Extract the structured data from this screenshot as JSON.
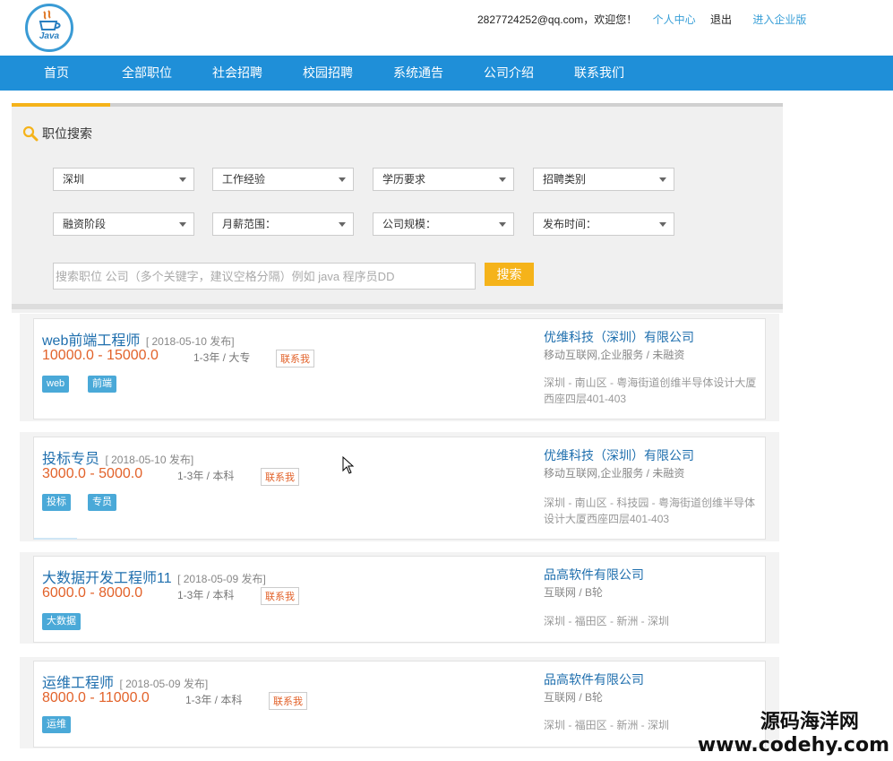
{
  "header": {
    "logo_text": "Java",
    "email": "2827724252@qq.com",
    "welcome": "，欢迎您！",
    "personal_center": "个人中心",
    "logout": "退出",
    "enterprise": "进入企业版"
  },
  "nav": {
    "items": [
      "首页",
      "全部职位",
      "社会招聘",
      "校园招聘",
      "系统通告",
      "公司介绍",
      "联系我们"
    ]
  },
  "search": {
    "title": "职位搜索",
    "filters": [
      "深圳",
      "工作经验",
      "学历要求",
      "招聘类别",
      "融资阶段",
      "月薪范围：",
      "公司规模：",
      "发布时间："
    ],
    "placeholder": "搜索职位 公司（多个关键字，建议空格分隔）例如 java 程序员DD",
    "button": "搜索"
  },
  "jobs": [
    {
      "title": "web前端工程师",
      "date": "[ 2018-05-10 发布]",
      "salary": "10000.0 - 15000.0",
      "experience": "1-3年 / 大专",
      "contact": "联系我",
      "tags": [
        "web",
        "前端"
      ],
      "company": "优维科技（深圳）有限公司",
      "industry": "移动互联网,企业服务 / 未融资",
      "address": "深圳 - 南山区 - 粤海街道创维半导体设计大厦西座四层401-403"
    },
    {
      "title": "投标专员",
      "date": "[ 2018-05-10 发布]",
      "salary": "3000.0 - 5000.0",
      "experience": "1-3年 / 本科",
      "contact": "联系我",
      "tags": [
        "投标",
        "专员"
      ],
      "company": "优维科技（深圳）有限公司",
      "industry": "移动互联网,企业服务 / 未融资",
      "address": "深圳 - 南山区 - 科技园 - 粤海街道创维半导体设计大厦西座四层401-403"
    },
    {
      "title": "大数据开发工程师11",
      "date": "[ 2018-05-09 发布]",
      "salary": "6000.0 - 8000.0",
      "experience": "1-3年 / 本科",
      "contact": "联系我",
      "tags": [
        "大数据"
      ],
      "company": "品高软件有限公司",
      "industry": "互联网 / B轮",
      "address": "深圳 - 福田区 - 新洲 - 深圳"
    },
    {
      "title": "运维工程师",
      "date": "[ 2018-05-09 发布]",
      "salary": "8000.0 - 11000.0",
      "experience": "1-3年 / 本科",
      "contact": "联系我",
      "tags": [
        "运维"
      ],
      "company": "品高软件有限公司",
      "industry": "互联网 / B轮",
      "address": "深圳 - 福田区 - 新洲 - 深圳"
    }
  ],
  "watermark": {
    "line1": "源码海洋网",
    "line2": "www.codehy.com"
  },
  "colors": {
    "nav": "#1f8fd8",
    "accent": "#f5b31a",
    "salary": "#e2622a",
    "tag": "#4aa9d8",
    "link": "#1f6fae"
  }
}
